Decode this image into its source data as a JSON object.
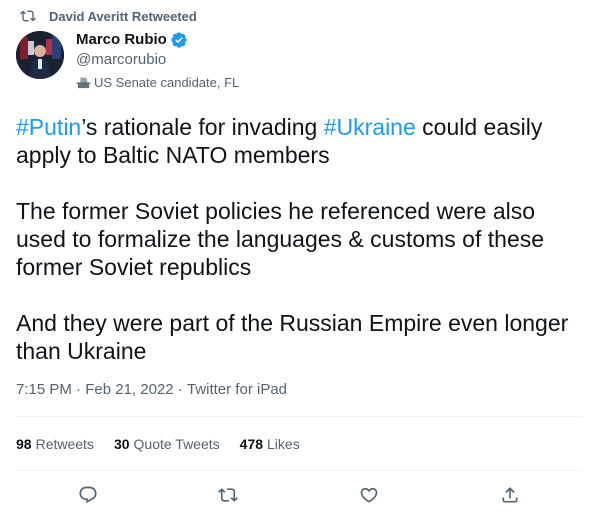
{
  "retweet": {
    "text": "David Averitt Retweeted",
    "icon": "retweet-icon"
  },
  "author": {
    "name": "Marco Rubio",
    "handle": "@marcorubio",
    "label": "US Senate candidate, FL",
    "verified_color": "#1d9bf0"
  },
  "tweet": {
    "p1_tag1": "#Putin",
    "p1_text1": "’s rationale for invading ",
    "p1_tag2": "#Ukraine",
    "p1_text2": " could easily apply to Baltic NATO members",
    "p2": "The former Soviet policies he referenced were also used to formalize the languages & customs of these former Soviet republics",
    "p3": "And they were part of the Russian Empire even longer than Ukraine"
  },
  "meta": {
    "time": "7:15 PM",
    "sep": " · ",
    "date": "Feb 21, 2022",
    "source": "Twitter for iPad"
  },
  "stats": [
    {
      "count": "98",
      "label": "Retweets"
    },
    {
      "count": "30",
      "label": "Quote Tweets"
    },
    {
      "count": "478",
      "label": "Likes"
    }
  ],
  "actions": [
    "reply-icon",
    "retweet-icon",
    "like-icon",
    "share-icon"
  ],
  "colors": {
    "accent": "#1d9bf0",
    "secondary_text": "#536471",
    "divider": "#eff3f4"
  }
}
